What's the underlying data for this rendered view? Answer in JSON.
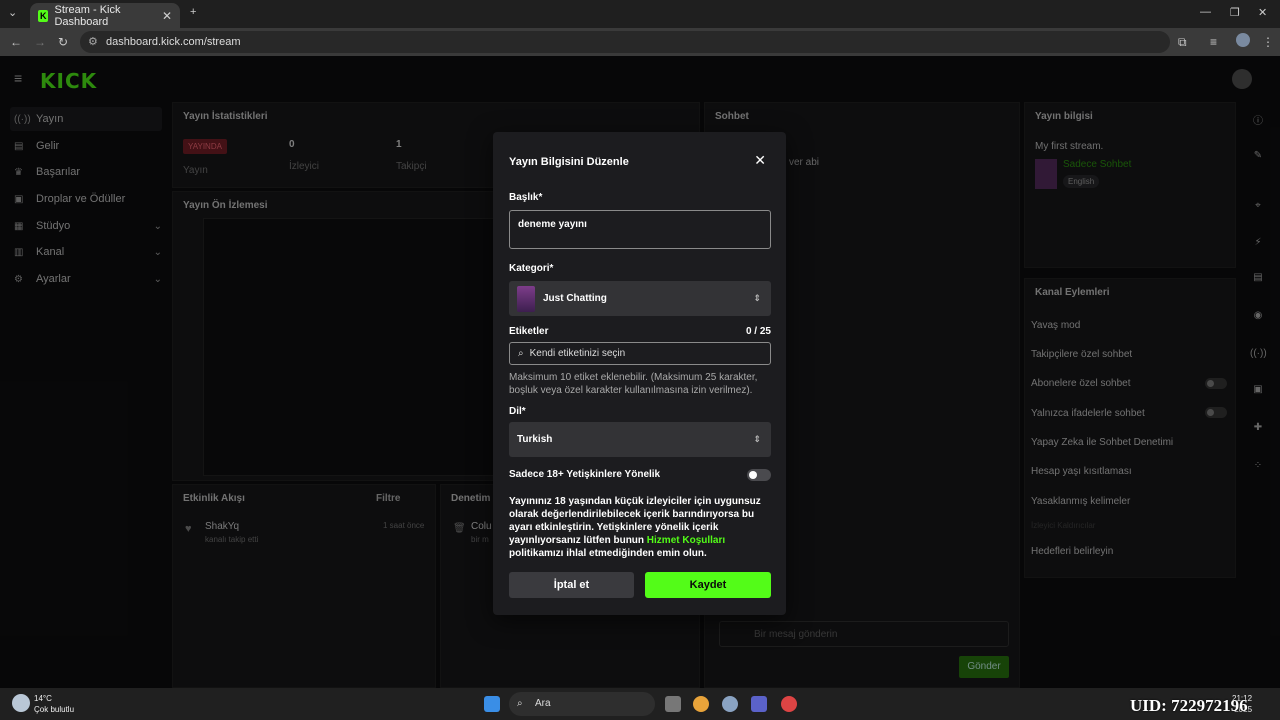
{
  "browser": {
    "tab_title": "Stream - Kick Dashboard",
    "url": "dashboard.kick.com/stream"
  },
  "sidebar": {
    "logo": "KICK",
    "items": [
      {
        "label": "Yayın",
        "icon": "stream-icon"
      },
      {
        "label": "Gelir",
        "icon": "revenue-icon"
      },
      {
        "label": "Başarılar",
        "icon": "trophy-icon"
      },
      {
        "label": "Droplar ve Ödüller",
        "icon": "gift-icon"
      },
      {
        "label": "Stüdyo",
        "icon": "studio-icon"
      },
      {
        "label": "Kanal",
        "icon": "channel-icon"
      },
      {
        "label": "Ayarlar",
        "icon": "settings-icon"
      }
    ]
  },
  "stats": {
    "title": "Yayın İstatistikleri",
    "live_badge": "YAYINDA",
    "live_label": "Yayın",
    "viewers_value": "0",
    "viewers_label": "İzleyici",
    "followers_value": "1",
    "followers_label": "Takipçi"
  },
  "preview": {
    "title": "Yayın Ön İzlemesi"
  },
  "activity": {
    "title": "Etkinlik Akışı",
    "filter": "Filtre",
    "user": "ShakYq",
    "event": "kanalı takip etti",
    "time": "1 saat önce"
  },
  "moderation": {
    "title": "Denetim",
    "item": "Colu",
    "item_sub": "bir m"
  },
  "chat": {
    "title": "Sohbet",
    "message_tail": "ver abi",
    "input_placeholder": "Bir mesaj gönderin",
    "send": "Gönder"
  },
  "stream_info": {
    "title": "Yayın bilgisi",
    "stream_title": "My first stream.",
    "category": "Sadece Sohbet",
    "language": "English"
  },
  "channel_actions": {
    "title": "Kanal Eylemleri",
    "items": [
      "Yavaş mod",
      "Takipçilere özel sohbet",
      "Abonelere özel sohbet",
      "Yalnızca ifadelerle sohbet",
      "Yapay Zeka ile Sohbet Denetimi",
      "Hesap yaşı kısıtlaması",
      "Yasaklanmış kelimeler",
      "Hedefleri belirleyin"
    ],
    "sub_hint": "İzleyici Kaldırıcılar"
  },
  "modal": {
    "title": "Yayın Bilgisini Düzenle",
    "title_label": "Başlık*",
    "title_value": "deneme yayını",
    "category_label": "Kategori*",
    "category_value": "Just Chatting",
    "tags_label": "Etiketler",
    "tags_count": "0 / 25",
    "tags_placeholder": "Kendi etiketinizi seçin",
    "tags_help": "Maksimum 10 etiket eklenebilir. (Maksimum 25 karakter, boşluk veya özel karakter kullanılmasına izin verilmez).",
    "language_label": "Dil*",
    "language_value": "Turkish",
    "adult_label": "Sadece 18+ Yetişkinlere Yönelik",
    "adult_enabled": false,
    "adult_desc_before": "Yayınınız 18 yaşından küçük izleyiciler için uygunsuz olarak değerlendirilebilecek içerik barındırıyorsa bu ayarı etkinleştirin. Yetişkinlere yönelik içerik yayınlıyorsanız lütfen bunun ",
    "adult_desc_link": "Hizmet Koşulları",
    "adult_desc_after": " politikamızı ihlal etmediğinden emin olun.",
    "cancel": "İptal et",
    "save": "Kaydet",
    "accent": "#53fc18"
  },
  "taskbar": {
    "weather_temp": "14°C",
    "weather_desc": "Çok bulutlu",
    "search": "Ara",
    "time": "21:12",
    "date": "2025"
  },
  "overlay": {
    "uid": "UID: 722972196"
  }
}
